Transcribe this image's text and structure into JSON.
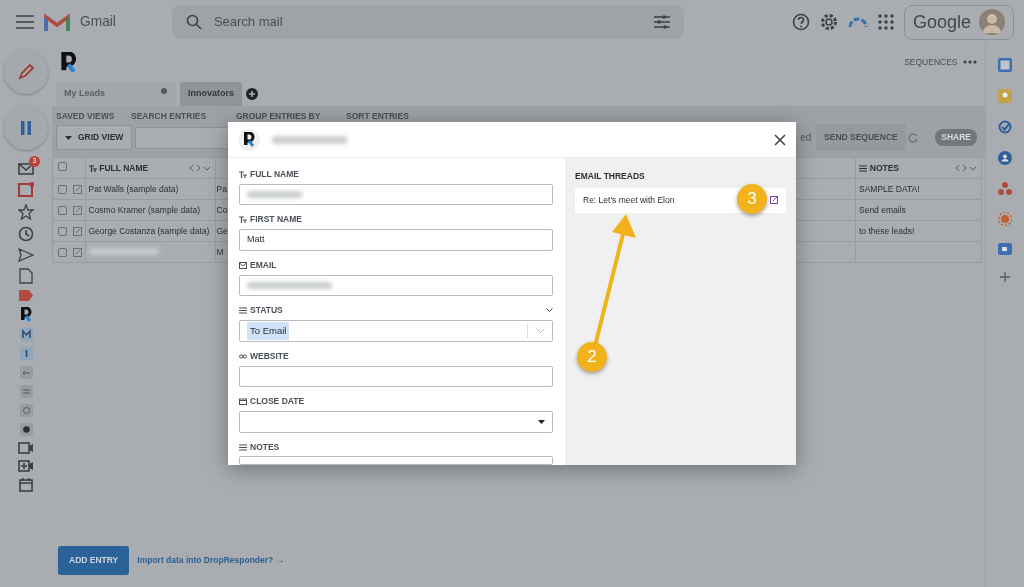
{
  "topbar": {
    "app_name": "Gmail",
    "search": {
      "placeholder": "Search mail"
    },
    "account": "Google"
  },
  "mail_nav": {
    "inbox_badge": "3"
  },
  "crm": {
    "tabs": [
      {
        "label": "My Leads",
        "selected": false
      },
      {
        "label": "Innovators",
        "selected": true
      }
    ],
    "sequences_link": "SEQUENCES",
    "toolbar_labels": [
      "SAVED VIEWS",
      "SEARCH ENTRIES",
      "GROUP ENTRIES BY",
      "SORT ENTRIES"
    ],
    "view_button": "GRID VIEW",
    "partial_text": "ed",
    "send_button": "SEND SEQUENCE",
    "share_button": "SHARE",
    "table": {
      "select_all_checked": false,
      "columns": [
        {
          "label": "FULL NAME"
        },
        {
          "label": "NOTES"
        }
      ],
      "rows": [
        {
          "checked": false,
          "name": "Pat Walls (sample data)",
          "column_2": "Pa",
          "notes": "SAMPLE DATA!",
          "blurred": false
        },
        {
          "checked": false,
          "name": "Cosmo Kramer (sample data)",
          "column_2": "Co",
          "notes": "Send emails",
          "blurred": false
        },
        {
          "checked": false,
          "name": "George Costanza (sample data)",
          "column_2": "Ge",
          "notes": "to these leads!",
          "blurred": false
        },
        {
          "checked": false,
          "column_2": "M",
          "blurred": true
        }
      ]
    },
    "add_button": "ADD ENTRY",
    "import_link": "Import data into DropResponder? →"
  },
  "modal": {
    "title_blurred": true,
    "fields": [
      {
        "label": "FULL NAME",
        "kind": "text",
        "blurred": true
      },
      {
        "label": "FIRST NAME",
        "kind": "text",
        "value": "Matt",
        "blurred": false
      },
      {
        "label": "EMAIL",
        "kind": "email",
        "blurred": true
      },
      {
        "label": "STATUS",
        "kind": "select",
        "value": "To Email",
        "blurred": false
      },
      {
        "label": "WEBSITE",
        "kind": "link",
        "blurred": false
      },
      {
        "label": "CLOSE DATE",
        "kind": "date",
        "blurred": false
      },
      {
        "label": "NOTES",
        "kind": "notes",
        "blurred": false
      }
    ],
    "threads_title": "EMAIL THREADS",
    "threads": [
      {
        "subject": "Re: Let's meet with Elon"
      }
    ]
  },
  "annotations": [
    {
      "label": "2"
    },
    {
      "label": "3"
    }
  ]
}
